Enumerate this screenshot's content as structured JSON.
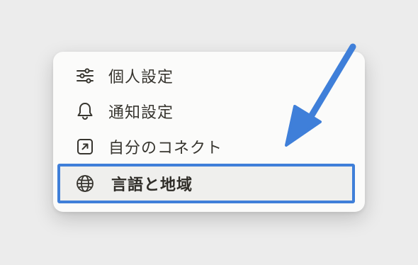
{
  "menu": {
    "items": [
      {
        "label": "個人設定",
        "icon": "sliders-icon"
      },
      {
        "label": "通知設定",
        "icon": "bell-icon"
      },
      {
        "label": "自分のコネクト",
        "icon": "external-link-icon"
      },
      {
        "label": "言語と地域",
        "icon": "globe-icon",
        "highlighted": true
      }
    ]
  },
  "colors": {
    "highlight_border": "#3f7fd9",
    "arrow": "#3f7fd9",
    "text": "#37352f",
    "menu_bg": "#fbfbfa",
    "page_bg": "#ececec"
  }
}
